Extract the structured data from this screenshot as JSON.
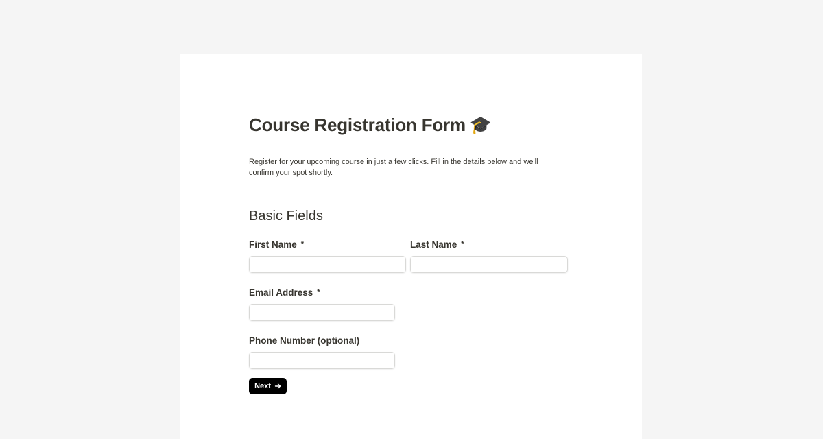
{
  "form": {
    "title": "Course Registration Form",
    "title_emoji": "🎓",
    "description": "Register for your upcoming course in just a few clicks. Fill in the details below and we'll confirm your spot shortly.",
    "section_title": "Basic Fields",
    "required_marker": "*",
    "fields": {
      "first_name": {
        "label": "First Name",
        "value": ""
      },
      "last_name": {
        "label": "Last Name",
        "value": ""
      },
      "email": {
        "label": "Email Address",
        "value": ""
      },
      "phone": {
        "label": "Phone Number (optional)",
        "value": ""
      }
    },
    "next_button": {
      "label": "Next",
      "icon": "arrow-right-icon"
    }
  }
}
